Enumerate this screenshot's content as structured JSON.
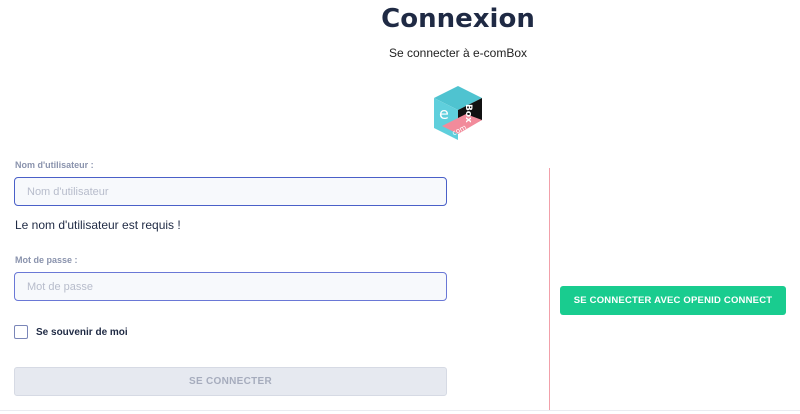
{
  "header": {
    "title": "Connexion",
    "subtitle": "Se connecter à e-comBox"
  },
  "logo": {
    "letters": [
      "e",
      "Box",
      "com"
    ],
    "colors": {
      "cyan": "#5fcfdc",
      "black": "#111111",
      "pink": "#f28b9b"
    }
  },
  "form": {
    "username": {
      "label": "Nom d'utilisateur :",
      "placeholder": "Nom d'utilisateur",
      "value": "",
      "error": "Le nom d'utilisateur est requis !"
    },
    "password": {
      "label": "Mot de passe :",
      "placeholder": "Mot de passe",
      "value": ""
    },
    "remember_label": "Se souvenir de moi",
    "remember_checked": false,
    "submit_label": "SE CONNECTER"
  },
  "openid": {
    "label": "SE CONNECTER AVEC OPENID CONNECT"
  },
  "colors": {
    "accent": "#19cc8f",
    "title": "#1f2a44",
    "divider": "#f2a0aa",
    "focus_border": "#4a60c8"
  }
}
